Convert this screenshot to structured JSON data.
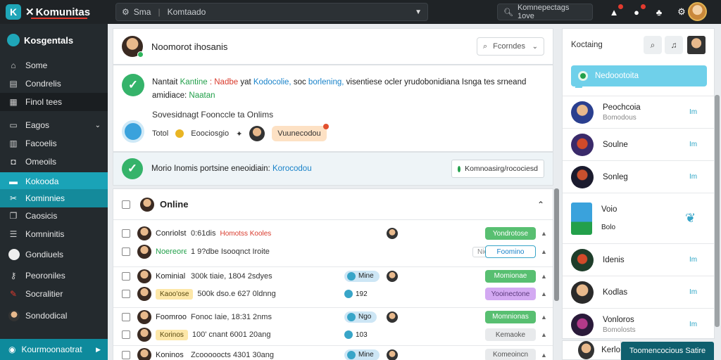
{
  "app": {
    "title": "Komunitas",
    "logo_letter": "K"
  },
  "topbar": {
    "search_left": "Sma",
    "search_placeholder": "Komtaado",
    "search_right": "Komnepectags 1ove"
  },
  "sidebar": {
    "header": "Kosgentals",
    "items": [
      {
        "label": "Some",
        "icon": "home-icon"
      },
      {
        "label": "Condrelis",
        "icon": "document-icon"
      },
      {
        "label": "Finol tees",
        "icon": "list-icon"
      },
      {
        "label": "Eagos",
        "icon": "folder-icon"
      },
      {
        "label": "Facoelis",
        "icon": "grid-icon"
      },
      {
        "label": "Omeoils",
        "icon": "chat-icon"
      },
      {
        "label": "Kokooda",
        "icon": "card-icon"
      },
      {
        "label": "Kominnies",
        "icon": "tools-icon"
      },
      {
        "label": "Caosicis",
        "icon": "copy-icon"
      },
      {
        "label": "Komninitis",
        "icon": "list-icon"
      },
      {
        "label": "Gondiuels",
        "icon": "user-icon"
      },
      {
        "label": "Peoroniles",
        "icon": "key-icon"
      },
      {
        "label": "Socralitier",
        "icon": "pin-icon"
      },
      {
        "label": "Sondodical",
        "icon": "avatar-icon"
      }
    ],
    "bottom": "Kourmoonaotrat"
  },
  "post": {
    "title": "Noomorot ihosanis",
    "filter": "Fcorndes",
    "line1_a": "Nantait",
    "line1_b": "Kantine",
    "line1_c": ": Nadbe",
    "line1_d": "yat",
    "line1_e": "Kodocolie,",
    "line1_f": "soc",
    "line1_g": "borlening,",
    "line1_h": "visentiese ocler yrudobonidiana Isnga tes srneand",
    "line1_i": "amidiace:",
    "line1_j": "Naatan",
    "line2": "Sovesidnagt Foonccle ta Onlims",
    "meta_a": "Totol",
    "meta_b": "Eoociosgio",
    "meta_c": "Vuunecodou",
    "banner_text": "Morio Inomis portsine eneoidiain:",
    "banner_link": "Korocodou",
    "banner_btn": "Komnoasirg/rocociesd"
  },
  "online": {
    "title": "Online",
    "rows": [
      {
        "name": "Conriolst",
        "meta": "0:61dis",
        "tag": "Homotss Kooles",
        "tag_style": "red",
        "status": "Yondrotose",
        "status_style": "green"
      },
      {
        "name": "Noereore",
        "meta": "1 9?dbe Isooqnct Iroite",
        "name_style": "green",
        "chip": "Nice",
        "status": "Foomino",
        "status_style": "outline"
      },
      {
        "name": "Kominial",
        "meta": "300k tiaie, 1804 2sdyes",
        "chip": "Mine",
        "status": "Momionae",
        "status_style": "green"
      },
      {
        "name": "Kaoo'ose",
        "meta": "500k dso.e 627 0ldnng",
        "name_style": "chip",
        "chip": "192",
        "status": "Yooinectone",
        "status_style": "purple"
      },
      {
        "name": "Foomrood",
        "meta": "Fonoc Iaie, 18:31 2nms",
        "chip": "Ngo",
        "status": "Momnionas",
        "status_style": "green"
      },
      {
        "name": "Korinos",
        "meta": "100' cnant 6001 20ang",
        "name_style": "chip",
        "chip": "103",
        "status": "Kemaoke",
        "status_style": "grey"
      },
      {
        "name": "Koninos",
        "meta": "Zcooooocts 4301 30ang",
        "chip": "Mine",
        "status": "Komeoincn",
        "status_style": "grey"
      }
    ]
  },
  "right_panel": {
    "title": "Koctaing",
    "banner": "Nedoootoita",
    "friends": [
      {
        "name": "Peochcoia",
        "sub": "Bomodous",
        "link": "Im"
      },
      {
        "name": "Soulne",
        "sub": "",
        "link": "Im"
      },
      {
        "name": "Sonleg",
        "sub": "",
        "link": "Im"
      },
      {
        "name": "Voio",
        "sub": "Bolo",
        "link": ""
      },
      {
        "name": "Idenis",
        "sub": "",
        "link": "Im"
      },
      {
        "name": "Kodlas",
        "sub": "",
        "link": "Im"
      },
      {
        "name": "Vonloros",
        "sub": "Bomolosts",
        "link": "Im"
      }
    ],
    "bottom_name": "Kerlo",
    "cta": "Toomencocious Satire"
  },
  "colors": {
    "accent": "#1aa3b7",
    "green": "#35b36a",
    "dark": "#1f2326"
  }
}
